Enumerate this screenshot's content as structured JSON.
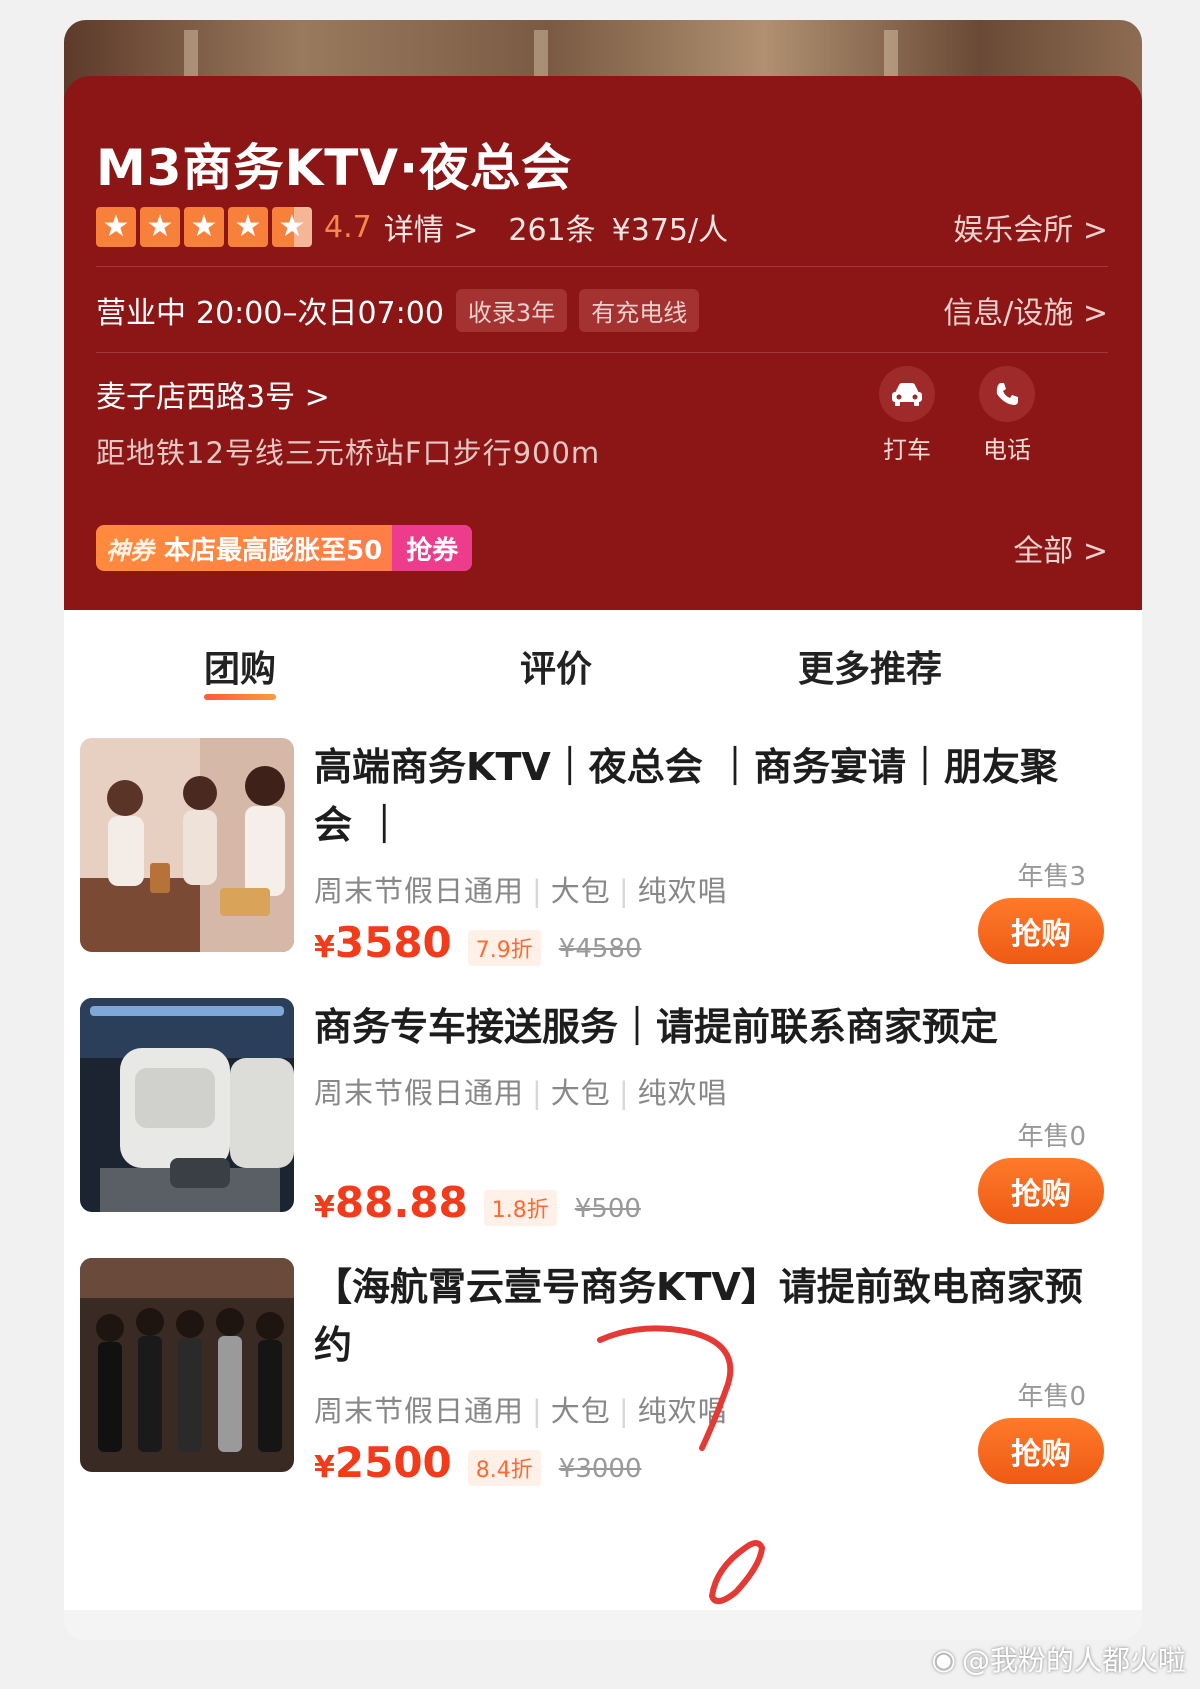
{
  "shop": {
    "name": "M3商务KTV·夜总会",
    "score": "4.7",
    "detail_link": "详情 >",
    "reviews": "261条",
    "price_per_person": "¥375/人",
    "category": "娱乐会所 >",
    "hours_status": "营业中",
    "hours_time": "20:00–次日07:00",
    "tags": [
      "收录3年",
      "有充电线"
    ],
    "info_link": "信息/设施 >",
    "address": "麦子店西路3号 >",
    "metro": "距地铁12号线三元桥站F口步行900m",
    "actions": [
      {
        "label": "打车",
        "icon": "car-icon"
      },
      {
        "label": "电话",
        "icon": "phone-icon"
      }
    ],
    "coupon": {
      "tag": "神券",
      "text": "本店最高膨胀至50",
      "button": "抢券"
    },
    "all_link": "全部 >",
    "rating_stars": 4.5,
    "brand_color": "#8c1516",
    "accent_color": "#f33a1b"
  },
  "tabs": [
    {
      "label": "团购",
      "active": true
    },
    {
      "label": "评价",
      "active": false
    },
    {
      "label": "更多推荐",
      "active": false
    }
  ],
  "deals": [
    {
      "title": "高端商务KTV｜夜总会 ｜商务宴请｜朋友聚会 ｜",
      "tags": [
        "周末节假日通用",
        "大包",
        "纯欢唱"
      ],
      "sold": "年售3",
      "currency": "¥",
      "price": "3580",
      "discount": "7.9折",
      "original": "¥4580",
      "buy_label": "抢购"
    },
    {
      "title": "商务专车接送服务｜请提前联系商家预定",
      "tags": [
        "周末节假日通用",
        "大包",
        "纯欢唱"
      ],
      "sold": "年售0",
      "currency": "¥",
      "price": "88.88",
      "discount": "1.8折",
      "original": "¥500",
      "buy_label": "抢购"
    },
    {
      "title": "【海航霄云壹号商务KTV】请提前致电商家预约",
      "tags": [
        "周末节假日通用",
        "大包",
        "纯欢唱"
      ],
      "sold": "年售0",
      "currency": "¥",
      "price": "2500",
      "discount": "8.4折",
      "original": "¥3000",
      "buy_label": "抢购"
    }
  ],
  "watermark": "@我粉的人都火啦"
}
